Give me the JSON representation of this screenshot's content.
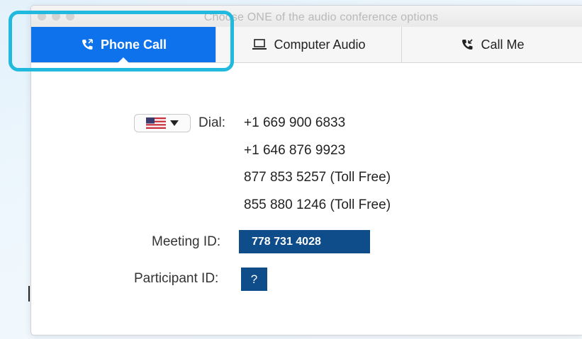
{
  "window": {
    "title": "Choose ONE of the audio conference options"
  },
  "tabs": [
    {
      "label": "Phone Call",
      "icon": "phone-icon",
      "active": true
    },
    {
      "label": "Computer Audio",
      "icon": "laptop-icon",
      "active": false
    },
    {
      "label": "Call Me",
      "icon": "phone-callback-icon",
      "active": false
    }
  ],
  "dial": {
    "label": "Dial:",
    "country_flag": "us-flag-icon",
    "numbers": [
      "+1 669 900 6833",
      "+1 646 876 9923",
      "877 853 5257 (Toll Free)",
      "855 880 1246 (Toll Free)"
    ]
  },
  "meeting": {
    "label": "Meeting ID:",
    "value": "778 731 4028"
  },
  "participant": {
    "label": "Participant ID:",
    "value": "?"
  },
  "colors": {
    "active_tab": "#0e72ed",
    "highlight": "#22b9de",
    "id_box": "#0e4c8a"
  }
}
